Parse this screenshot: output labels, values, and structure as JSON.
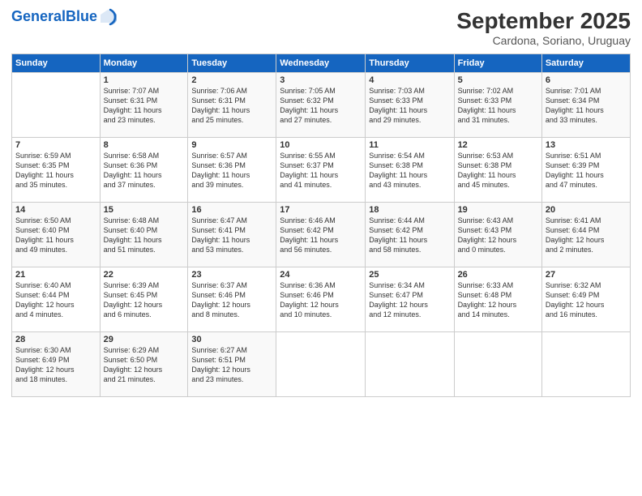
{
  "header": {
    "logo_general": "General",
    "logo_blue": "Blue",
    "month": "September 2025",
    "location": "Cardona, Soriano, Uruguay"
  },
  "weekdays": [
    "Sunday",
    "Monday",
    "Tuesday",
    "Wednesday",
    "Thursday",
    "Friday",
    "Saturday"
  ],
  "weeks": [
    [
      {
        "day": "",
        "info": ""
      },
      {
        "day": "1",
        "info": "Sunrise: 7:07 AM\nSunset: 6:31 PM\nDaylight: 11 hours\nand 23 minutes."
      },
      {
        "day": "2",
        "info": "Sunrise: 7:06 AM\nSunset: 6:31 PM\nDaylight: 11 hours\nand 25 minutes."
      },
      {
        "day": "3",
        "info": "Sunrise: 7:05 AM\nSunset: 6:32 PM\nDaylight: 11 hours\nand 27 minutes."
      },
      {
        "day": "4",
        "info": "Sunrise: 7:03 AM\nSunset: 6:33 PM\nDaylight: 11 hours\nand 29 minutes."
      },
      {
        "day": "5",
        "info": "Sunrise: 7:02 AM\nSunset: 6:33 PM\nDaylight: 11 hours\nand 31 minutes."
      },
      {
        "day": "6",
        "info": "Sunrise: 7:01 AM\nSunset: 6:34 PM\nDaylight: 11 hours\nand 33 minutes."
      }
    ],
    [
      {
        "day": "7",
        "info": "Sunrise: 6:59 AM\nSunset: 6:35 PM\nDaylight: 11 hours\nand 35 minutes."
      },
      {
        "day": "8",
        "info": "Sunrise: 6:58 AM\nSunset: 6:36 PM\nDaylight: 11 hours\nand 37 minutes."
      },
      {
        "day": "9",
        "info": "Sunrise: 6:57 AM\nSunset: 6:36 PM\nDaylight: 11 hours\nand 39 minutes."
      },
      {
        "day": "10",
        "info": "Sunrise: 6:55 AM\nSunset: 6:37 PM\nDaylight: 11 hours\nand 41 minutes."
      },
      {
        "day": "11",
        "info": "Sunrise: 6:54 AM\nSunset: 6:38 PM\nDaylight: 11 hours\nand 43 minutes."
      },
      {
        "day": "12",
        "info": "Sunrise: 6:53 AM\nSunset: 6:38 PM\nDaylight: 11 hours\nand 45 minutes."
      },
      {
        "day": "13",
        "info": "Sunrise: 6:51 AM\nSunset: 6:39 PM\nDaylight: 11 hours\nand 47 minutes."
      }
    ],
    [
      {
        "day": "14",
        "info": "Sunrise: 6:50 AM\nSunset: 6:40 PM\nDaylight: 11 hours\nand 49 minutes."
      },
      {
        "day": "15",
        "info": "Sunrise: 6:48 AM\nSunset: 6:40 PM\nDaylight: 11 hours\nand 51 minutes."
      },
      {
        "day": "16",
        "info": "Sunrise: 6:47 AM\nSunset: 6:41 PM\nDaylight: 11 hours\nand 53 minutes."
      },
      {
        "day": "17",
        "info": "Sunrise: 6:46 AM\nSunset: 6:42 PM\nDaylight: 11 hours\nand 56 minutes."
      },
      {
        "day": "18",
        "info": "Sunrise: 6:44 AM\nSunset: 6:42 PM\nDaylight: 11 hours\nand 58 minutes."
      },
      {
        "day": "19",
        "info": "Sunrise: 6:43 AM\nSunset: 6:43 PM\nDaylight: 12 hours\nand 0 minutes."
      },
      {
        "day": "20",
        "info": "Sunrise: 6:41 AM\nSunset: 6:44 PM\nDaylight: 12 hours\nand 2 minutes."
      }
    ],
    [
      {
        "day": "21",
        "info": "Sunrise: 6:40 AM\nSunset: 6:44 PM\nDaylight: 12 hours\nand 4 minutes."
      },
      {
        "day": "22",
        "info": "Sunrise: 6:39 AM\nSunset: 6:45 PM\nDaylight: 12 hours\nand 6 minutes."
      },
      {
        "day": "23",
        "info": "Sunrise: 6:37 AM\nSunset: 6:46 PM\nDaylight: 12 hours\nand 8 minutes."
      },
      {
        "day": "24",
        "info": "Sunrise: 6:36 AM\nSunset: 6:46 PM\nDaylight: 12 hours\nand 10 minutes."
      },
      {
        "day": "25",
        "info": "Sunrise: 6:34 AM\nSunset: 6:47 PM\nDaylight: 12 hours\nand 12 minutes."
      },
      {
        "day": "26",
        "info": "Sunrise: 6:33 AM\nSunset: 6:48 PM\nDaylight: 12 hours\nand 14 minutes."
      },
      {
        "day": "27",
        "info": "Sunrise: 6:32 AM\nSunset: 6:49 PM\nDaylight: 12 hours\nand 16 minutes."
      }
    ],
    [
      {
        "day": "28",
        "info": "Sunrise: 6:30 AM\nSunset: 6:49 PM\nDaylight: 12 hours\nand 18 minutes."
      },
      {
        "day": "29",
        "info": "Sunrise: 6:29 AM\nSunset: 6:50 PM\nDaylight: 12 hours\nand 21 minutes."
      },
      {
        "day": "30",
        "info": "Sunrise: 6:27 AM\nSunset: 6:51 PM\nDaylight: 12 hours\nand 23 minutes."
      },
      {
        "day": "",
        "info": ""
      },
      {
        "day": "",
        "info": ""
      },
      {
        "day": "",
        "info": ""
      },
      {
        "day": "",
        "info": ""
      }
    ]
  ]
}
